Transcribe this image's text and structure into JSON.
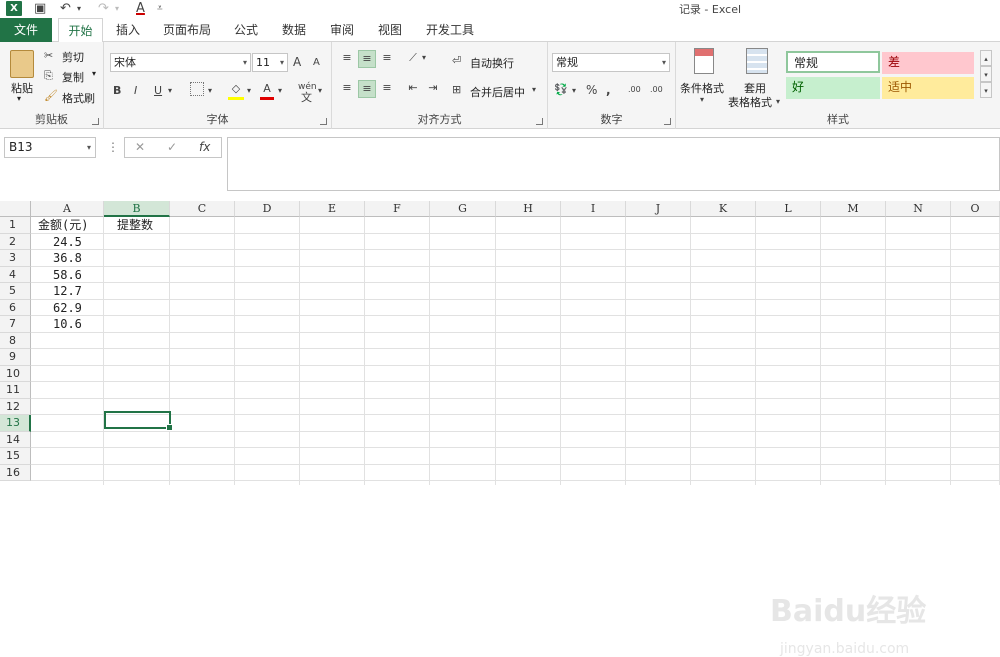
{
  "window": {
    "title": "记录 - Excel"
  },
  "tabs": [
    "文件",
    "开始",
    "插入",
    "页面布局",
    "公式",
    "数据",
    "审阅",
    "视图",
    "开发工具"
  ],
  "ribbon": {
    "clipboard": {
      "paste": "粘贴",
      "cut": "剪切",
      "copy": "复制",
      "format_painter": "格式刷",
      "label": "剪贴板"
    },
    "font": {
      "name": "宋体",
      "size": "11",
      "bold": "B",
      "italic": "I",
      "underline": "U",
      "grow": "A",
      "shrink": "A",
      "font_color_icon": "A",
      "phonetic": "wén",
      "label": "字体"
    },
    "alignment": {
      "wrap": "自动换行",
      "merge": "合并后居中",
      "label": "对齐方式"
    },
    "number": {
      "format": "常规",
      "percent": "%",
      "comma": ",",
      "inc_decimal": ".00",
      "dec_decimal": ".00",
      "label": "数字"
    },
    "styles": {
      "conditional": "条件格式",
      "table1": "套用",
      "table2": "表格格式",
      "normal": "常规",
      "bad": "差",
      "good": "好",
      "neutral": "适中",
      "label": "样式"
    }
  },
  "formula_bar": {
    "name_box": "B13",
    "fx": "fx",
    "cancel": "✕",
    "confirm": "✓",
    "formula": ""
  },
  "columns": [
    "A",
    "B",
    "C",
    "D",
    "E",
    "F",
    "G",
    "H",
    "I",
    "J",
    "K",
    "L",
    "M",
    "N",
    "O"
  ],
  "rows": [
    "1",
    "2",
    "3",
    "4",
    "5",
    "6",
    "7",
    "8",
    "9",
    "10",
    "11",
    "12",
    "13",
    "14",
    "15",
    "16"
  ],
  "cells": {
    "A1": "金额(元)",
    "B1": "提整数",
    "A2": "24.5",
    "A3": "36.8",
    "A4": "58.6",
    "A5": "12.7",
    "A6": "62.9",
    "A7": "10.6"
  },
  "selected_cell": "B13",
  "watermark": {
    "main": "Baidu经验",
    "sub": "jingyan.baidu.com"
  },
  "colors": {
    "excel_green": "#217346",
    "bad_fill": "#ffc7ce",
    "good_fill": "#c6efce",
    "neutral_fill": "#ffeb9c"
  }
}
